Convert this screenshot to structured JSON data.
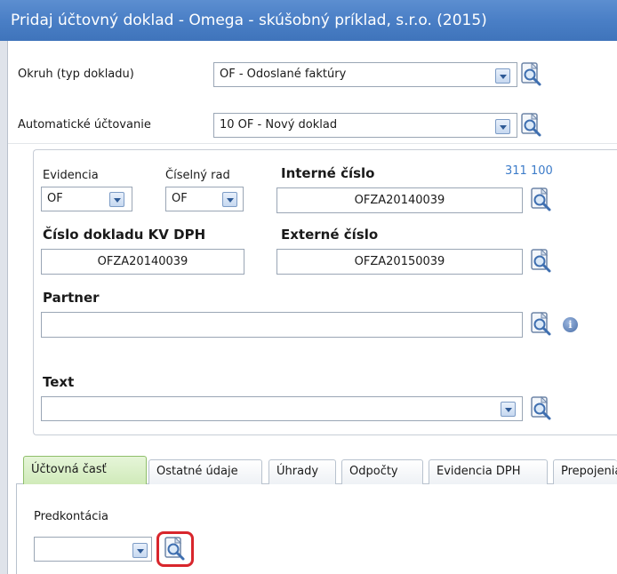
{
  "window": {
    "title": "Pridaj účtovný doklad - Omega - skúšobný príklad, s.r.o. (2015)"
  },
  "header_fields": {
    "okruh": {
      "label": "Okruh (typ dokladu)",
      "value": "OF - Odoslané faktúry"
    },
    "automaticke": {
      "label": "Automatické účtovanie",
      "value": "10 OF - Nový doklad"
    }
  },
  "document": {
    "evidencia": {
      "label": "Evidencia",
      "value": "OF"
    },
    "ciselny_rad": {
      "label": "Číselný rad",
      "value": "OF"
    },
    "interne_cislo": {
      "label": "Interné číslo",
      "value": "OFZA20140039",
      "counter": "311  100"
    },
    "cislo_kv_dph": {
      "label": "Číslo dokladu KV DPH",
      "value": "OFZA20140039"
    },
    "externe_cislo": {
      "label": "Externé číslo",
      "value": "OFZA20150039"
    },
    "partner": {
      "label": "Partner",
      "value": ""
    },
    "text": {
      "label": "Text",
      "value": ""
    }
  },
  "tabs": [
    {
      "label": "Účtovná časť",
      "active": true
    },
    {
      "label": "Ostatné údaje",
      "active": false
    },
    {
      "label": "Úhrady",
      "active": false
    },
    {
      "label": "Odpočty",
      "active": false
    },
    {
      "label": "Evidencia DPH",
      "active": false
    },
    {
      "label": "Prepojenia",
      "active": false
    }
  ],
  "tab_content": {
    "predkontacia": {
      "label": "Predkontácia",
      "value": ""
    }
  },
  "colors": {
    "titlebar": "#4a7fc6",
    "active_tab": "#cfeab8",
    "highlight": "#d8262c",
    "counter": "#3d7cc9"
  },
  "icons": {
    "lookup": "magnifier-page-icon",
    "dropdown": "chevron-down-icon",
    "info": "info-icon"
  }
}
